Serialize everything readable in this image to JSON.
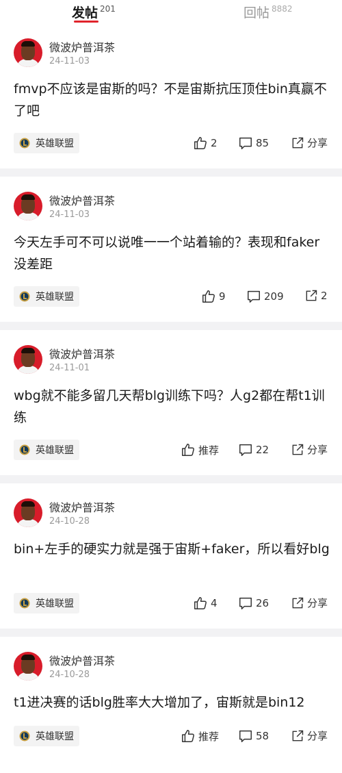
{
  "tabs": [
    {
      "label": "发帖",
      "count": "201",
      "active": true
    },
    {
      "label": "回帖",
      "count": "8882",
      "active": false
    }
  ],
  "posts": [
    {
      "author": "微波炉普洱茶",
      "date": "24-11-03",
      "text": "fmvp不应该是宙斯的吗？不是宙斯抗压顶住bin真赢不了吧",
      "tag": "英雄联盟",
      "likes": "2",
      "comments": "85",
      "shares": "分享"
    },
    {
      "author": "微波炉普洱茶",
      "date": "24-11-03",
      "text": "今天左手可不可以说唯一一个站着输的？表现和faker没差距",
      "tag": "英雄联盟",
      "likes": "9",
      "comments": "209",
      "shares": "2"
    },
    {
      "author": "微波炉普洱茶",
      "date": "24-11-01",
      "text": "wbg就不能多留几天帮blg训练下吗？人g2都在帮t1训练",
      "tag": "英雄联盟",
      "likes": "推荐",
      "comments": "22",
      "shares": "分享"
    },
    {
      "author": "微波炉普洱茶",
      "date": "24-10-28",
      "text": "bin+左手的硬实力就是强于宙斯+faker，所以看好blg",
      "tag": "英雄联盟",
      "likes": "4",
      "comments": "26",
      "shares": "分享"
    },
    {
      "author": "微波炉普洱茶",
      "date": "24-10-28",
      "text": "t1进决赛的话blg胜率大大增加了，宙斯就是bin12",
      "tag": "英雄联盟",
      "likes": "推荐",
      "comments": "58",
      "shares": "分享"
    }
  ],
  "icons": {
    "like": "thumbs-up-icon",
    "comment": "comment-bubble-icon",
    "share": "share-arrow-icon",
    "tag": "league-of-legends-icon"
  },
  "colors": {
    "accent": "#e0232b",
    "avatar_bg": "#d81c2a",
    "page_bg": "#f2f2f4"
  }
}
